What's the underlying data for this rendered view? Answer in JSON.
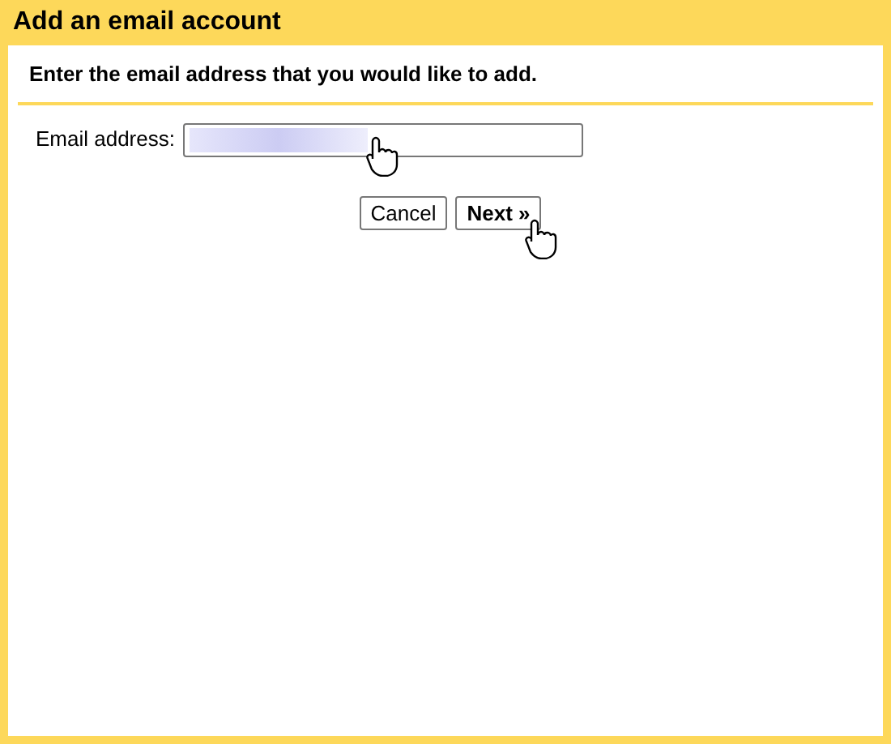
{
  "window": {
    "title": "Add an email account"
  },
  "instruction": "Enter the email address that you would like to add.",
  "email_field": {
    "label": "Email address:"
  },
  "buttons": [
    {
      "label": "Cancel",
      "kind": "plain"
    },
    {
      "label": "Next »",
      "kind": "primary"
    }
  ]
}
